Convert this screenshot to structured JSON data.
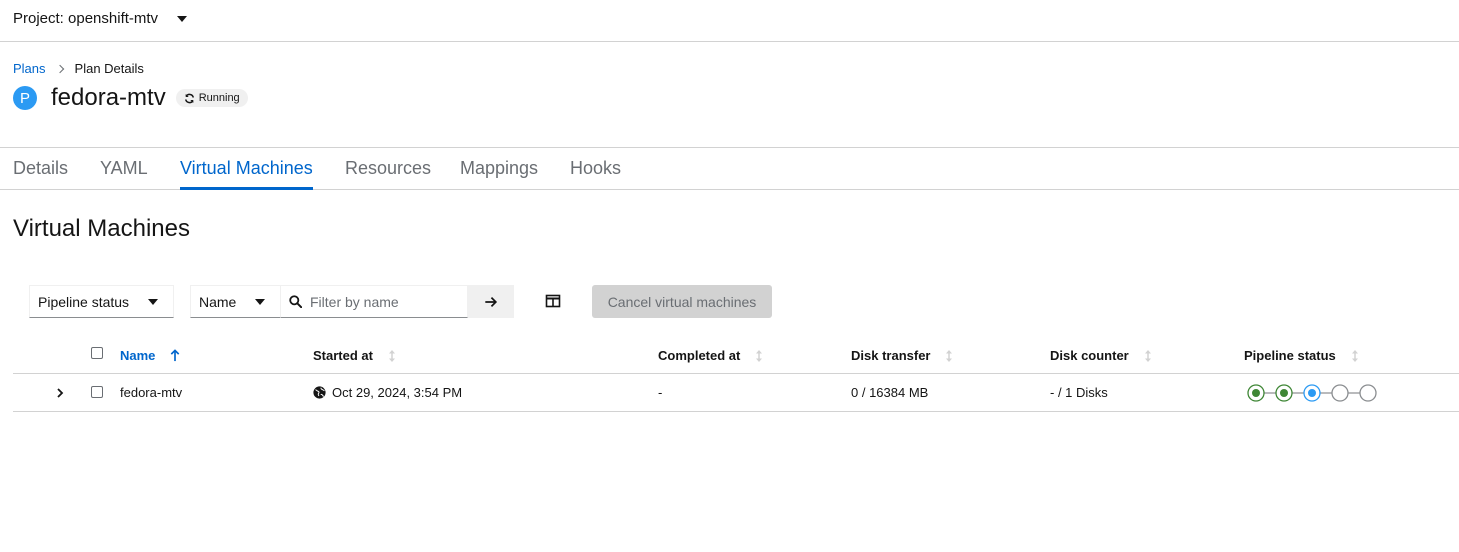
{
  "project": {
    "label": "Project: openshift-mtv"
  },
  "breadcrumb": {
    "root": "Plans",
    "current": "Plan Details"
  },
  "plan": {
    "badge": "P",
    "name": "fedora-mtv",
    "status": "Running"
  },
  "tabs": [
    {
      "label": "Details",
      "active": false
    },
    {
      "label": "YAML",
      "active": false
    },
    {
      "label": "Virtual Machines",
      "active": true
    },
    {
      "label": "Resources",
      "active": false
    },
    {
      "label": "Mappings",
      "active": false
    },
    {
      "label": "Hooks",
      "active": false
    }
  ],
  "section": {
    "title": "Virtual Machines"
  },
  "toolbar": {
    "status_filter": "Pipeline status",
    "attribute_filter": "Name",
    "search_placeholder": "Filter by name",
    "cancel_label": "Cancel virtual machines"
  },
  "table": {
    "headers": {
      "name": "Name",
      "started": "Started at",
      "completed": "Completed at",
      "disk_transfer": "Disk transfer",
      "disk_counter": "Disk counter",
      "pipeline": "Pipeline status"
    },
    "rows": [
      {
        "name": "fedora-mtv",
        "started": "Oct 29, 2024, 3:54 PM",
        "completed": "-",
        "disk_transfer": "0 / 16384 MB",
        "disk_counter": "- / 1 Disks",
        "pipeline": [
          "completed",
          "completed",
          "running",
          "pending",
          "pending"
        ]
      }
    ]
  },
  "colors": {
    "link": "#0066cc",
    "badge": "#2b9af3",
    "success": "#3e8635",
    "running": "#2b9af3",
    "pending": "#8a8d90"
  },
  "icons": [
    "caret-down-icon",
    "chevron-right-icon",
    "sync-icon",
    "search-icon",
    "arrow-right-icon",
    "columns-icon",
    "sort-asc-icon",
    "sort-icon",
    "globe-icon"
  ]
}
